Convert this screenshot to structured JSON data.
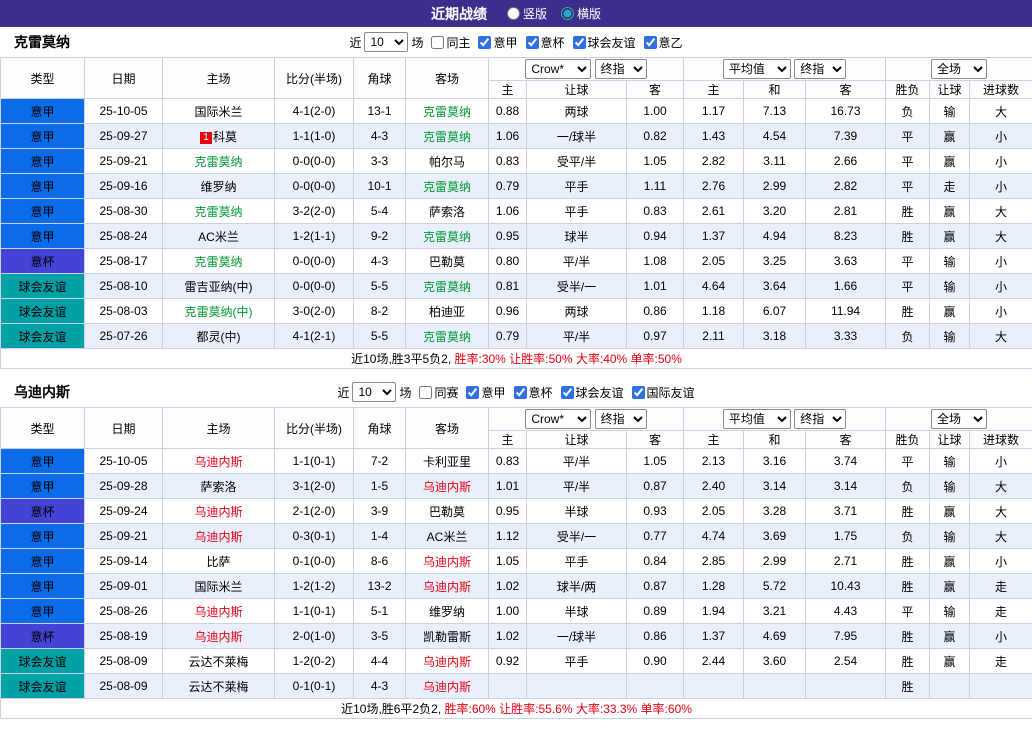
{
  "topbar": {
    "title": "近期战绩",
    "vertical_label": "竖版",
    "horizontal_label": "横版",
    "vertical_on": false,
    "horizontal_on": true
  },
  "filter_words": {
    "near": "近",
    "games": "场"
  },
  "columns": {
    "type": "类型",
    "date": "日期",
    "home": "主场",
    "score": "比分(半场)",
    "corner": "角球",
    "away": "客场",
    "odds_home": "主",
    "odds_handicap": "让球",
    "odds_away": "客",
    "avg_home": "主",
    "avg_draw": "和",
    "avg_away": "客",
    "result": "胜负",
    "give": "让球",
    "goals": "进球数",
    "sel_book": "Crow*",
    "sel_final": "终指",
    "sel_avg": "平均值",
    "sel_final2": "终指",
    "sel_scope": "全场"
  },
  "tables": [
    {
      "team": "克雷莫纳",
      "hl": "green",
      "count": "10",
      "checks": [
        {
          "label": "同主",
          "on": false
        },
        {
          "label": "意甲",
          "on": true
        },
        {
          "label": "意杯",
          "on": true
        },
        {
          "label": "球会友谊",
          "on": true
        },
        {
          "label": "意乙",
          "on": true
        }
      ],
      "rows": [
        {
          "type": "意甲",
          "tc": "lg",
          "date": "25-10-05",
          "home": {
            "n": "国际米兰"
          },
          "score": "4-1(2-0)",
          "corner": "13-1",
          "away": {
            "n": "克雷莫纳",
            "hl": true
          },
          "o": [
            "0.88",
            "两球",
            "1.00"
          ],
          "a": [
            "1.17",
            "7.13",
            "16.73"
          ],
          "res": [
            "负",
            "red"
          ],
          "giv": [
            "输",
            "blue"
          ],
          "gol": [
            "大",
            "red"
          ]
        },
        {
          "type": "意甲",
          "tc": "lg",
          "date": "25-09-27",
          "home": {
            "n": "科莫",
            "b": "1"
          },
          "score": "1-1(1-0)",
          "corner": "4-3",
          "away": {
            "n": "克雷莫纳",
            "hl": true
          },
          "o": [
            "1.06",
            "一/球半",
            "0.82"
          ],
          "a": [
            "1.43",
            "4.54",
            "7.39"
          ],
          "res": [
            "平",
            "green"
          ],
          "giv": [
            "赢",
            "red"
          ],
          "gol": [
            "小",
            "blue"
          ]
        },
        {
          "type": "意甲",
          "tc": "lg",
          "date": "25-09-21",
          "home": {
            "n": "克雷莫纳",
            "hl": true
          },
          "score": "0-0(0-0)",
          "corner": "3-3",
          "away": {
            "n": "帕尔马"
          },
          "o": [
            "0.83",
            "受平/半",
            "1.05"
          ],
          "a": [
            "2.82",
            "3.11",
            "2.66"
          ],
          "res": [
            "平",
            "green"
          ],
          "giv": [
            "赢",
            "red"
          ],
          "gol": [
            "小",
            "blue"
          ]
        },
        {
          "type": "意甲",
          "tc": "lg",
          "date": "25-09-16",
          "home": {
            "n": "维罗纳"
          },
          "score": "0-0(0-0)",
          "corner": "10-1",
          "away": {
            "n": "克雷莫纳",
            "hl": true
          },
          "o": [
            "0.79",
            "平手",
            "1.11"
          ],
          "a": [
            "2.76",
            "2.99",
            "2.82"
          ],
          "res": [
            "平",
            "green"
          ],
          "giv": [
            "走",
            "green"
          ],
          "gol": [
            "小",
            "blue"
          ]
        },
        {
          "type": "意甲",
          "tc": "lg",
          "date": "25-08-30",
          "home": {
            "n": "克雷莫纳",
            "hl": true
          },
          "score": "3-2(2-0)",
          "corner": "5-4",
          "away": {
            "n": "萨索洛"
          },
          "o": [
            "1.06",
            "平手",
            "0.83"
          ],
          "a": [
            "2.61",
            "3.20",
            "2.81"
          ],
          "res": [
            "胜",
            "red"
          ],
          "giv": [
            "赢",
            "red"
          ],
          "gol": [
            "大",
            "red"
          ]
        },
        {
          "type": "意甲",
          "tc": "lg",
          "date": "25-08-24",
          "home": {
            "n": "AC米兰"
          },
          "score": "1-2(1-1)",
          "corner": "9-2",
          "away": {
            "n": "克雷莫纳",
            "hl": true
          },
          "o": [
            "0.95",
            "球半",
            "0.94"
          ],
          "a": [
            "1.37",
            "4.94",
            "8.23"
          ],
          "res": [
            "胜",
            "red"
          ],
          "giv": [
            "赢",
            "red"
          ],
          "gol": [
            "大",
            "red"
          ]
        },
        {
          "type": "意杯",
          "tc": "cup",
          "date": "25-08-17",
          "home": {
            "n": "克雷莫纳",
            "hl": true
          },
          "score": "0-0(0-0)",
          "corner": "4-3",
          "away": {
            "n": "巴勒莫"
          },
          "o": [
            "0.80",
            "平/半",
            "1.08"
          ],
          "a": [
            "2.05",
            "3.25",
            "3.63"
          ],
          "res": [
            "平",
            "green"
          ],
          "giv": [
            "输",
            "blue"
          ],
          "gol": [
            "小",
            "blue"
          ]
        },
        {
          "type": "球会友谊",
          "tc": "fr",
          "date": "25-08-10",
          "home": {
            "n": "雷吉亚纳(中)"
          },
          "score": "0-0(0-0)",
          "corner": "5-5",
          "away": {
            "n": "克雷莫纳",
            "hl": true
          },
          "o": [
            "0.81",
            "受半/一",
            "1.01"
          ],
          "a": [
            "4.64",
            "3.64",
            "1.66"
          ],
          "res": [
            "平",
            "green"
          ],
          "giv": [
            "输",
            "blue"
          ],
          "gol": [
            "小",
            "blue"
          ]
        },
        {
          "type": "球会友谊",
          "tc": "fr",
          "date": "25-08-03",
          "home": {
            "n": "克雷莫纳(中)",
            "hl": true
          },
          "score": "3-0(2-0)",
          "corner": "8-2",
          "away": {
            "n": "柏迪亚"
          },
          "o": [
            "0.96",
            "两球",
            "0.86"
          ],
          "a": [
            "1.18",
            "6.07",
            "11.94"
          ],
          "res": [
            "胜",
            "red"
          ],
          "giv": [
            "赢",
            "red"
          ],
          "gol": [
            "小",
            "blue"
          ]
        },
        {
          "type": "球会友谊",
          "tc": "fr",
          "date": "25-07-26",
          "home": {
            "n": "都灵(中)"
          },
          "score": "4-1(2-1)",
          "corner": "5-5",
          "away": {
            "n": "克雷莫纳",
            "hl": true
          },
          "o": [
            "0.79",
            "平/半",
            "0.97"
          ],
          "a": [
            "2.11",
            "3.18",
            "3.33"
          ],
          "res": [
            "负",
            "red"
          ],
          "giv": [
            "输",
            "blue"
          ],
          "gol": [
            "大",
            "red"
          ]
        }
      ],
      "summary_prefix": "近10场,胜3平5负2, ",
      "summary_stats": "胜率:30% 让胜率:50% 大率:40% 单率:50%"
    },
    {
      "team": "乌迪内斯",
      "hl": "red",
      "count": "10",
      "checks": [
        {
          "label": "同赛",
          "on": false
        },
        {
          "label": "意甲",
          "on": true
        },
        {
          "label": "意杯",
          "on": true
        },
        {
          "label": "球会友谊",
          "on": true
        },
        {
          "label": "国际友谊",
          "on": true
        }
      ],
      "rows": [
        {
          "type": "意甲",
          "tc": "lg",
          "date": "25-10-05",
          "home": {
            "n": "乌迪内斯",
            "hl": true
          },
          "score": "1-1(0-1)",
          "corner": "7-2",
          "away": {
            "n": "卡利亚里"
          },
          "o": [
            "0.83",
            "平/半",
            "1.05"
          ],
          "a": [
            "2.13",
            "3.16",
            "3.74"
          ],
          "res": [
            "平",
            "green"
          ],
          "giv": [
            "输",
            "blue"
          ],
          "gol": [
            "小",
            "blue"
          ]
        },
        {
          "type": "意甲",
          "tc": "lg",
          "date": "25-09-28",
          "home": {
            "n": "萨索洛"
          },
          "score": "3-1(2-0)",
          "corner": "1-5",
          "away": {
            "n": "乌迪内斯",
            "hl": true
          },
          "o": [
            "1.01",
            "平/半",
            "0.87"
          ],
          "a": [
            "2.40",
            "3.14",
            "3.14"
          ],
          "res": [
            "负",
            "red"
          ],
          "giv": [
            "输",
            "blue"
          ],
          "gol": [
            "大",
            "red"
          ]
        },
        {
          "type": "意杯",
          "tc": "cup",
          "date": "25-09-24",
          "home": {
            "n": "乌迪内斯",
            "hl": true
          },
          "score": "2-1(2-0)",
          "corner": "3-9",
          "away": {
            "n": "巴勒莫"
          },
          "o": [
            "0.95",
            "半球",
            "0.93"
          ],
          "a": [
            "2.05",
            "3.28",
            "3.71"
          ],
          "res": [
            "胜",
            "red"
          ],
          "giv": [
            "赢",
            "red"
          ],
          "gol": [
            "大",
            "red"
          ]
        },
        {
          "type": "意甲",
          "tc": "lg",
          "date": "25-09-21",
          "home": {
            "n": "乌迪内斯",
            "hl": true
          },
          "score": "0-3(0-1)",
          "corner": "1-4",
          "away": {
            "n": "AC米兰"
          },
          "o": [
            "1.12",
            "受半/一",
            "0.77"
          ],
          "a": [
            "4.74",
            "3.69",
            "1.75"
          ],
          "res": [
            "负",
            "red"
          ],
          "giv": [
            "输",
            "blue"
          ],
          "gol": [
            "大",
            "red"
          ]
        },
        {
          "type": "意甲",
          "tc": "lg",
          "date": "25-09-14",
          "home": {
            "n": "比萨"
          },
          "score": "0-1(0-0)",
          "corner": "8-6",
          "away": {
            "n": "乌迪内斯",
            "hl": true
          },
          "o": [
            "1.05",
            "平手",
            "0.84"
          ],
          "a": [
            "2.85",
            "2.99",
            "2.71"
          ],
          "res": [
            "胜",
            "red"
          ],
          "giv": [
            "赢",
            "red"
          ],
          "gol": [
            "小",
            "blue"
          ]
        },
        {
          "type": "意甲",
          "tc": "lg",
          "date": "25-09-01",
          "home": {
            "n": "国际米兰"
          },
          "score": "1-2(1-2)",
          "corner": "13-2",
          "away": {
            "n": "乌迪内斯",
            "hl": true
          },
          "o": [
            "1.02",
            "球半/两",
            "0.87"
          ],
          "a": [
            "1.28",
            "5.72",
            "10.43"
          ],
          "res": [
            "胜",
            "red"
          ],
          "giv": [
            "赢",
            "red"
          ],
          "gol": [
            "走",
            "green"
          ]
        },
        {
          "type": "意甲",
          "tc": "lg",
          "date": "25-08-26",
          "home": {
            "n": "乌迪内斯",
            "hl": true
          },
          "score": "1-1(0-1)",
          "corner": "5-1",
          "away": {
            "n": "维罗纳"
          },
          "o": [
            "1.00",
            "半球",
            "0.89"
          ],
          "a": [
            "1.94",
            "3.21",
            "4.43"
          ],
          "res": [
            "平",
            "green"
          ],
          "giv": [
            "输",
            "blue"
          ],
          "gol": [
            "走",
            "green"
          ]
        },
        {
          "type": "意杯",
          "tc": "cup",
          "date": "25-08-19",
          "home": {
            "n": "乌迪内斯",
            "hl": true
          },
          "score": "2-0(1-0)",
          "corner": "3-5",
          "away": {
            "n": "凯勒雷斯"
          },
          "o": [
            "1.02",
            "一/球半",
            "0.86"
          ],
          "a": [
            "1.37",
            "4.69",
            "7.95"
          ],
          "res": [
            "胜",
            "red"
          ],
          "giv": [
            "赢",
            "red"
          ],
          "gol": [
            "小",
            "blue"
          ]
        },
        {
          "type": "球会友谊",
          "tc": "fr",
          "date": "25-08-09",
          "home": {
            "n": "云达不莱梅"
          },
          "score": "1-2(0-2)",
          "corner": "4-4",
          "away": {
            "n": "乌迪内斯",
            "hl": true
          },
          "o": [
            "0.92",
            "平手",
            "0.90"
          ],
          "a": [
            "2.44",
            "3.60",
            "2.54"
          ],
          "res": [
            "胜",
            "red"
          ],
          "giv": [
            "赢",
            "red"
          ],
          "gol": [
            "走",
            "green"
          ]
        },
        {
          "type": "球会友谊",
          "tc": "fr",
          "date": "25-08-09",
          "home": {
            "n": "云达不莱梅"
          },
          "score": "0-1(0-1)",
          "corner": "4-3",
          "away": {
            "n": "乌迪内斯",
            "hl": true
          },
          "o": [
            "",
            "",
            ""
          ],
          "a": [
            "",
            "",
            ""
          ],
          "res": [
            "胜",
            "red"
          ],
          "giv": [
            "",
            ""
          ],
          "gol": [
            "",
            ""
          ]
        }
      ],
      "summary_prefix": "近10场,胜6平2负2, ",
      "summary_stats": "胜率:60% 让胜率:55.6% 大率:33.3% 单率:60%"
    }
  ]
}
